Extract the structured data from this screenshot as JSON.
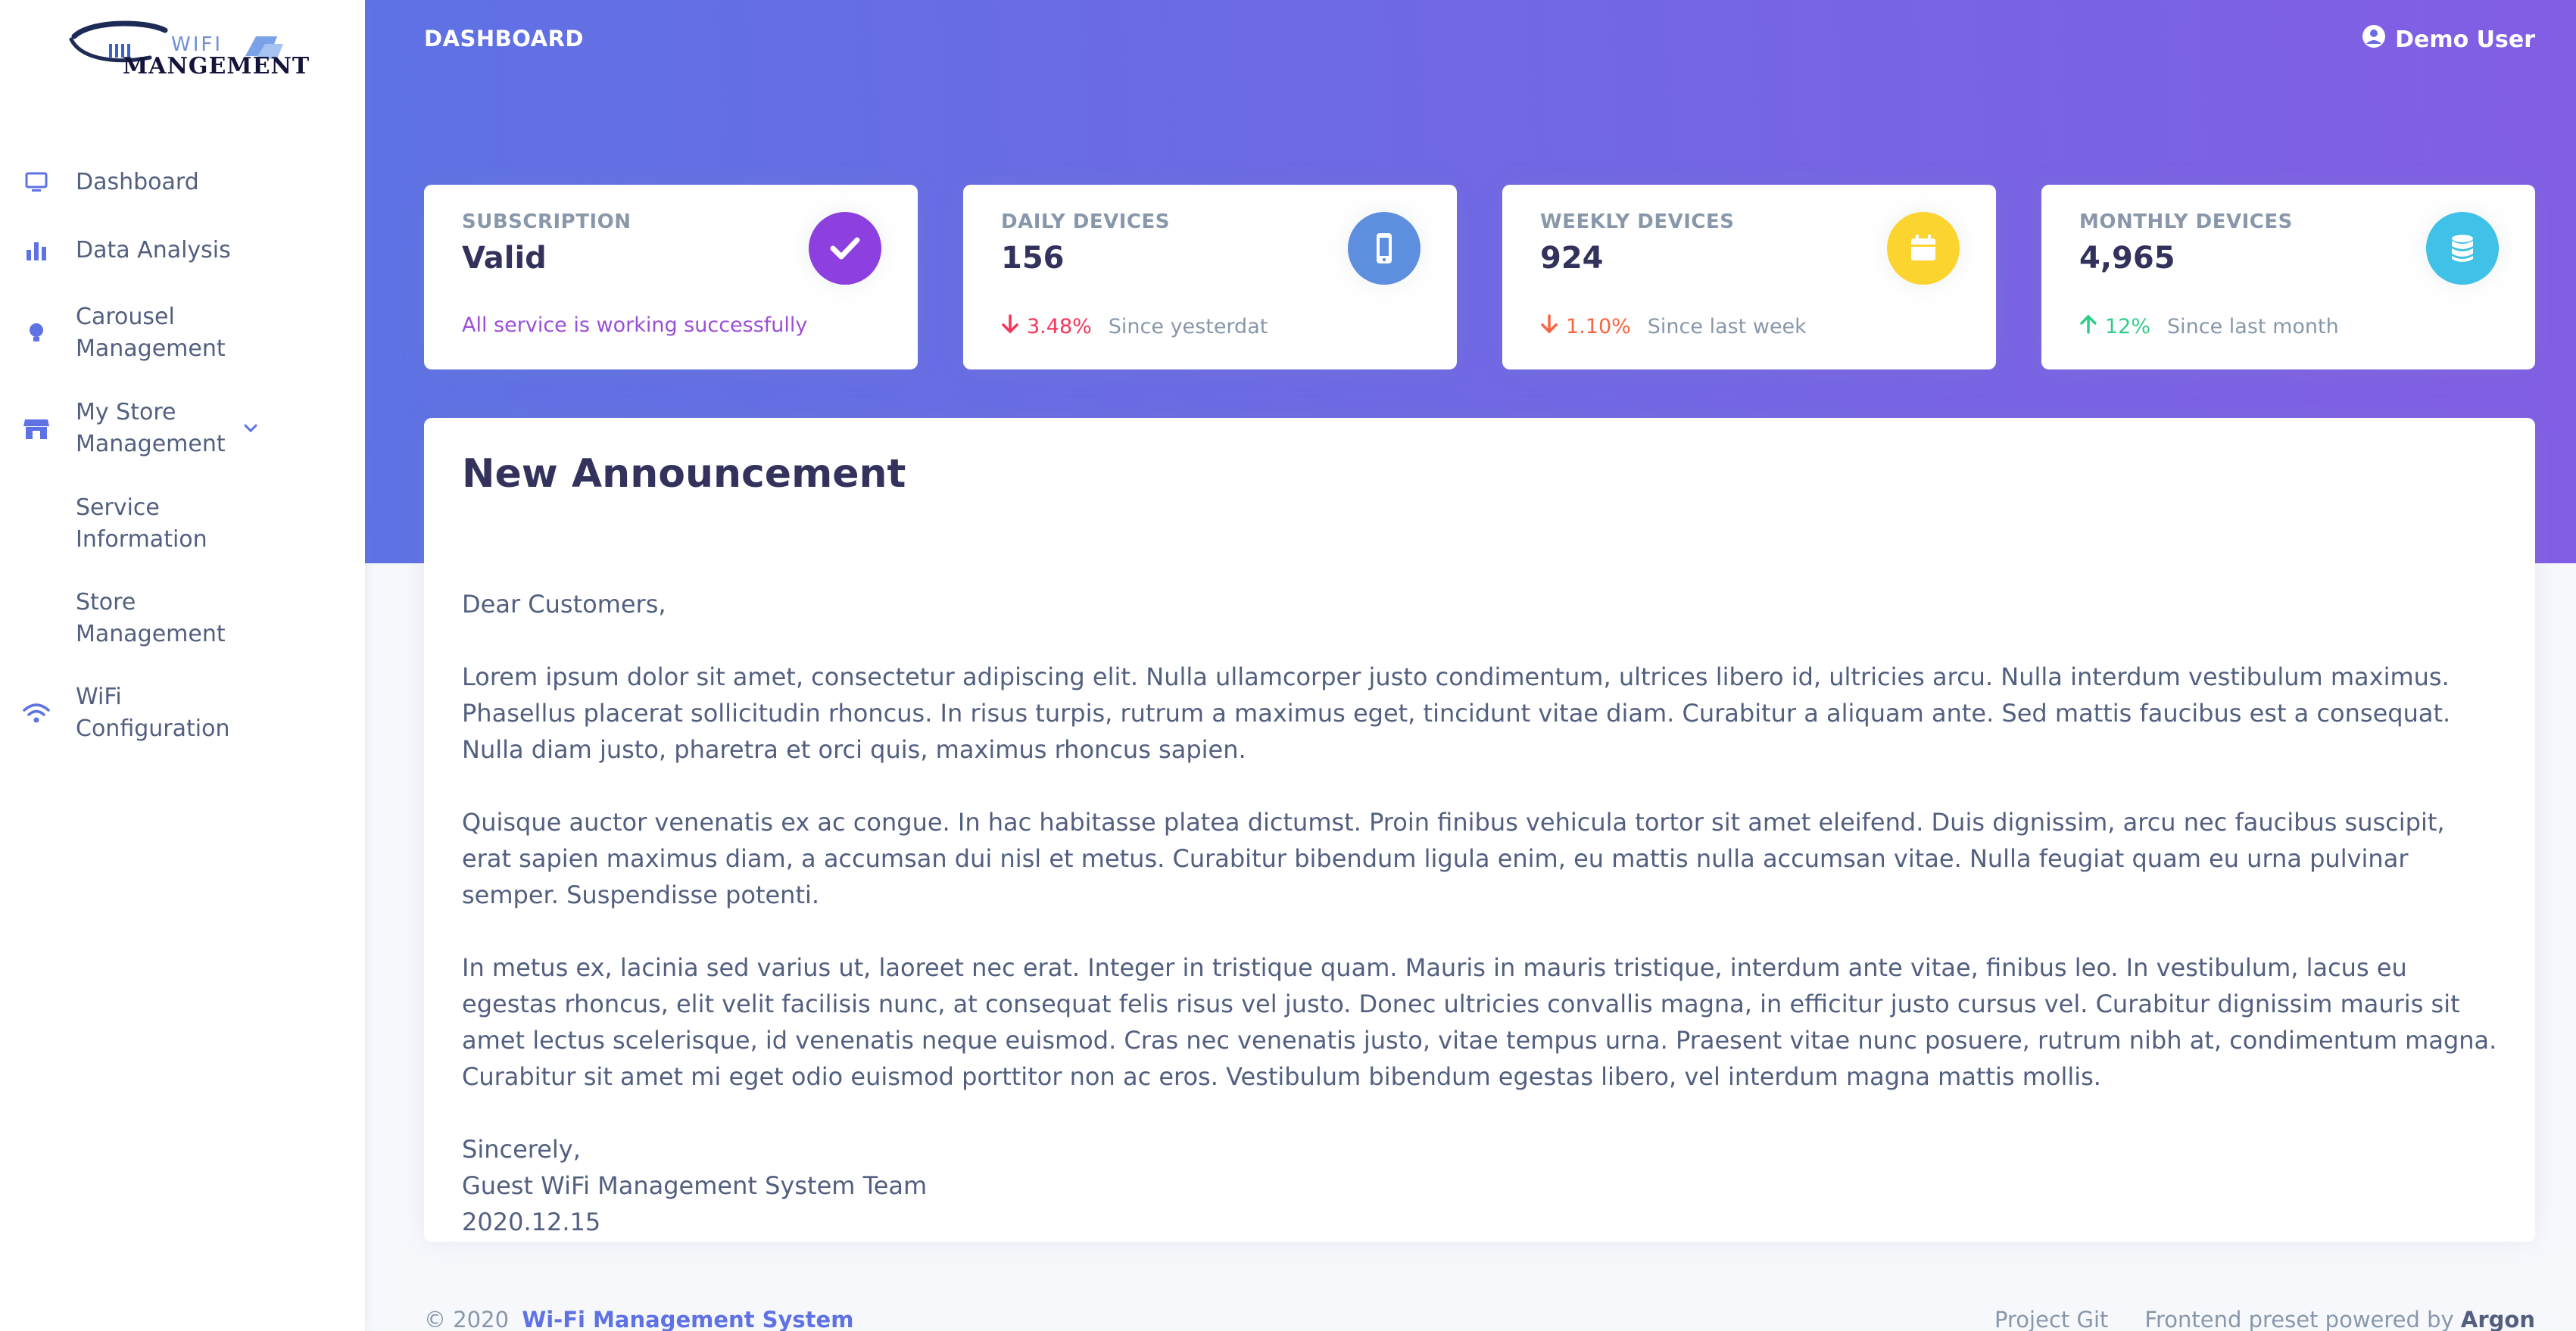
{
  "app": {
    "logo_text_top": "WIFI",
    "logo_text_bottom": "MANGEMENT"
  },
  "sidebar": {
    "items": [
      {
        "label": "Dashboard",
        "icon": "monitor-icon"
      },
      {
        "label": "Data Analysis",
        "icon": "bar-chart-icon"
      },
      {
        "label": "Carousel Management",
        "icon": "bulb-icon"
      },
      {
        "label": "My Store Management",
        "icon": "store-icon",
        "expanded": true
      },
      {
        "label": "Service Information",
        "icon": ""
      },
      {
        "label": "Store Management",
        "icon": ""
      },
      {
        "label": "WiFi Configuration",
        "icon": "wifi-icon"
      }
    ]
  },
  "header": {
    "page_title": "DASHBOARD",
    "user_name": "Demo User"
  },
  "stats": [
    {
      "label": "SUBSCRIPTION",
      "value": "Valid",
      "icon": "check-icon",
      "icon_color": "#8e3fe0",
      "foot_text": "All service is working successfully",
      "foot_color": "#9b4fd6"
    },
    {
      "label": "DAILY DEVICES",
      "value": "156",
      "icon": "mobile-icon",
      "icon_color": "#5e8fdf",
      "trend": "down",
      "trend_value": "3.48%",
      "trend_color": "#f5365c",
      "since": "Since yesterdat"
    },
    {
      "label": "WEEKLY DEVICES",
      "value": "924",
      "icon": "calendar-icon",
      "icon_color": "#fcd430",
      "trend": "down",
      "trend_value": "1.10%",
      "trend_color": "#fb6340",
      "since": "Since last week"
    },
    {
      "label": "MONTHLY DEVICES",
      "value": "4,965",
      "icon": "database-icon",
      "icon_color": "#3fc1e8",
      "trend": "up",
      "trend_value": "12%",
      "trend_color": "#2dce89",
      "since": "Since last month"
    }
  ],
  "announcement": {
    "title": "New Announcement",
    "greeting": "Dear Customers,",
    "paragraphs": [
      "Lorem ipsum dolor sit amet, consectetur adipiscing elit. Nulla ullamcorper justo condimentum, ultrices libero id, ultricies arcu. Nulla interdum vestibulum maximus. Phasellus placerat sollicitudin rhoncus. In risus turpis, rutrum a maximus eget, tincidunt vitae diam. Curabitur a aliquam ante. Sed mattis faucibus est a consequat. Nulla diam justo, pharetra et orci quis, maximus rhoncus sapien.",
      "Quisque auctor venenatis ex ac congue. In hac habitasse platea dictumst. Proin finibus vehicula tortor sit amet eleifend. Duis dignissim, arcu nec faucibus suscipit, erat sapien maximus diam, a accumsan dui nisl et metus. Curabitur bibendum ligula enim, eu mattis nulla accumsan vitae. Nulla feugiat quam eu urna pulvinar semper. Suspendisse potenti.",
      "In metus ex, lacinia sed varius ut, laoreet nec erat. Integer in tristique quam. Mauris in mauris tristique, interdum ante vitae, finibus leo. In vestibulum, lacus eu egestas rhoncus, elit velit facilisis nunc, at consequat felis risus vel justo. Donec ultricies convallis magna, in efficitur justo cursus vel. Curabitur dignissim mauris sit amet lectus scelerisque, id venenatis neque euismod. Cras nec venenatis justo, vitae tempus urna. Praesent vitae nunc posuere, rutrum nibh at, condimentum magna. Curabitur sit amet mi eget odio euismod porttitor non ac eros. Vestibulum bibendum egestas libero, vel interdum magna mattis mollis."
    ],
    "signoff": "Sincerely,",
    "team": "Guest WiFi Management System Team",
    "date": "2020.12.15"
  },
  "footer": {
    "copyright": "© 2020",
    "brand_link": "Wi-Fi Management System",
    "project_link": "Project Git",
    "powered_by": "Frontend preset powered by",
    "powered_name": "Argon"
  },
  "colors": {
    "gradient_start": "#5e72e4",
    "gradient_end": "#825ee4",
    "nav_icon": "#5e72e4"
  }
}
